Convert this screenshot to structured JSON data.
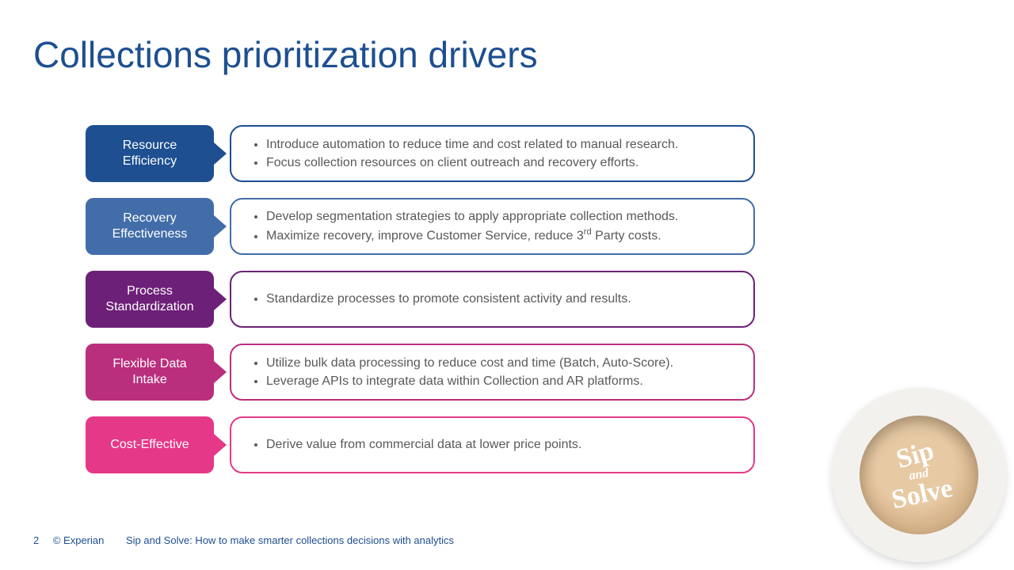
{
  "title": "Collections prioritization drivers",
  "rows": [
    {
      "label": "Resource\nEfficiency",
      "bullets": [
        "Introduce automation to reduce time and cost related to manual research.",
        "Focus collection resources on client outreach and recovery efforts."
      ]
    },
    {
      "label": "Recovery\nEffectiveness",
      "bullets": [
        "Develop segmentation strategies to apply appropriate collection methods.",
        "Maximize recovery, improve Customer Service, reduce 3rd Party costs."
      ]
    },
    {
      "label": "Process\nStandardization",
      "bullets": [
        "Standardize processes to promote consistent activity and results."
      ]
    },
    {
      "label": "Flexible Data\nIntake",
      "bullets": [
        "Utilize bulk data processing to reduce cost and time (Batch, Auto-Score).",
        "Leverage APIs to integrate data within Collection and AR platforms."
      ]
    },
    {
      "label": "Cost-Effective",
      "bullets": [
        "Derive value from commercial data at lower price points."
      ]
    }
  ],
  "footer": {
    "page": "2",
    "copyright": "© Experian",
    "series": "Sip and Solve:  How to make smarter collections decisions with analytics"
  },
  "logo": {
    "line1": "Sip",
    "line2": "and",
    "line3": "Solve"
  }
}
